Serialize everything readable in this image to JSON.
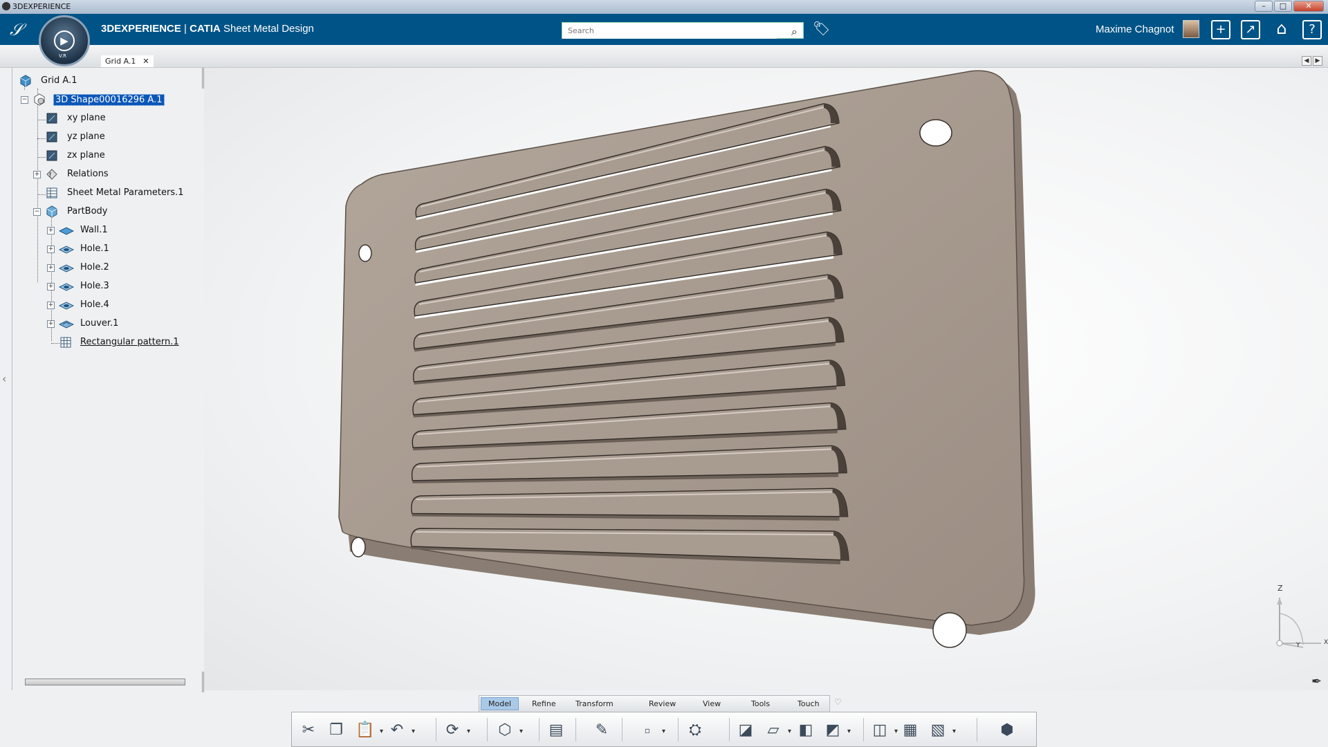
{
  "window": {
    "title": "3DEXPERIENCE",
    "buttons": {
      "minimize": "–",
      "maximize": "□",
      "close": "✕"
    }
  },
  "topbar": {
    "brand": "3DEXPERIENCE",
    "separator": " | ",
    "product": "CATIA",
    "app": " Sheet Metal Design",
    "compass_label": "V.R",
    "search_placeholder": "Search",
    "user": "Maxime Chagnot",
    "icons": [
      "tag-icon",
      "add-icon",
      "share-icon",
      "home-icon",
      "help-icon"
    ],
    "accent": "#005386"
  },
  "tabs": [
    {
      "label": "Grid A.1",
      "close": "✕"
    }
  ],
  "tree": {
    "root": "Grid A.1",
    "shape": "3D Shape00016296 A.1",
    "items": [
      {
        "label": "xy plane",
        "icon": "plane-icon"
      },
      {
        "label": "yz plane",
        "icon": "plane-icon"
      },
      {
        "label": "zx plane",
        "icon": "plane-icon"
      },
      {
        "label": "Relations",
        "icon": "relations-icon"
      },
      {
        "label": "Sheet Metal Parameters.1",
        "icon": "parameters-icon"
      },
      {
        "label": "PartBody",
        "icon": "partbody-icon"
      }
    ],
    "body_items": [
      {
        "label": "Wall.1",
        "icon": "wall-icon"
      },
      {
        "label": "Hole.1",
        "icon": "hole-icon"
      },
      {
        "label": "Hole.2",
        "icon": "hole-icon"
      },
      {
        "label": "Hole.3",
        "icon": "hole-icon"
      },
      {
        "label": "Hole.4",
        "icon": "hole-icon"
      },
      {
        "label": "Louver.1",
        "icon": "louver-icon"
      },
      {
        "label": "Rectangular pattern.1",
        "icon": "pattern-icon"
      }
    ]
  },
  "model": {
    "louver_count": 11,
    "plate_color": "#a89a8f"
  },
  "axis": {
    "z": "Z",
    "y": "Y",
    "x": "X"
  },
  "actionbar": {
    "tabs": [
      "Model",
      "Refine",
      "Transform",
      "Review",
      "View",
      "Tools",
      "Touch"
    ],
    "active_tab": "Model",
    "tools": [
      "cut-icon",
      "copy-icon",
      "paste-icon",
      "undo-icon",
      "update-icon",
      "sheet-metal-part-icon",
      "parameters-icon",
      "sketch-icon",
      "point-icon",
      "cut-out-icon",
      "bend-icon",
      "wall-icon",
      "flange-icon",
      "hem-icon",
      "stamp-icon",
      "pattern-icon",
      "measure-icon"
    ]
  }
}
